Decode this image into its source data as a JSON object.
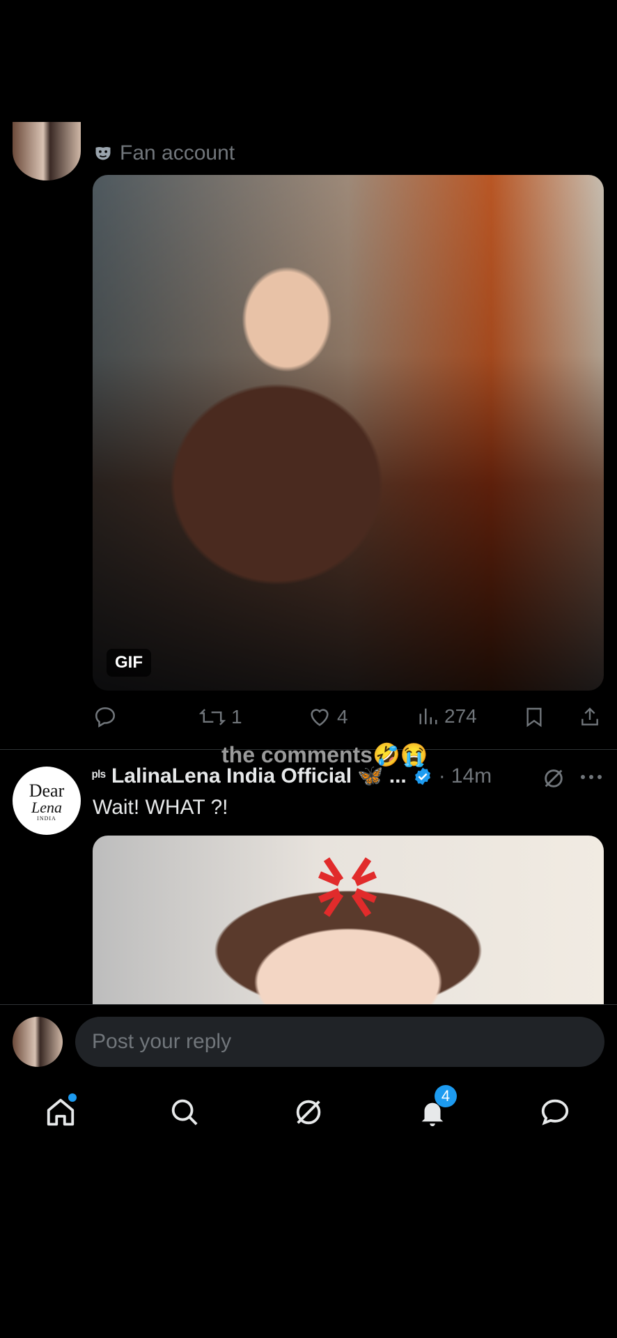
{
  "post1": {
    "account_label": "Fan account",
    "media_badge": "GIF",
    "actions": {
      "reposts": "1",
      "likes": "4",
      "views": "274"
    }
  },
  "overlay_caption": "the comments🤣😭",
  "post2": {
    "name_prefix": "ᵖˡˢ",
    "display_name": "LalinaLena India Official",
    "name_suffix": "🦋 ...",
    "dot": "·",
    "time": "14m",
    "text": "Wait! WHAT ?!",
    "avatar_text": {
      "line1": "Dear",
      "line2": "Lena",
      "line3": "INDIA"
    }
  },
  "reply": {
    "placeholder": "Post your reply"
  },
  "nav": {
    "notifications_count": "4"
  },
  "colors": {
    "accent": "#1d9bf0",
    "muted": "#71767b",
    "background": "#000000"
  }
}
